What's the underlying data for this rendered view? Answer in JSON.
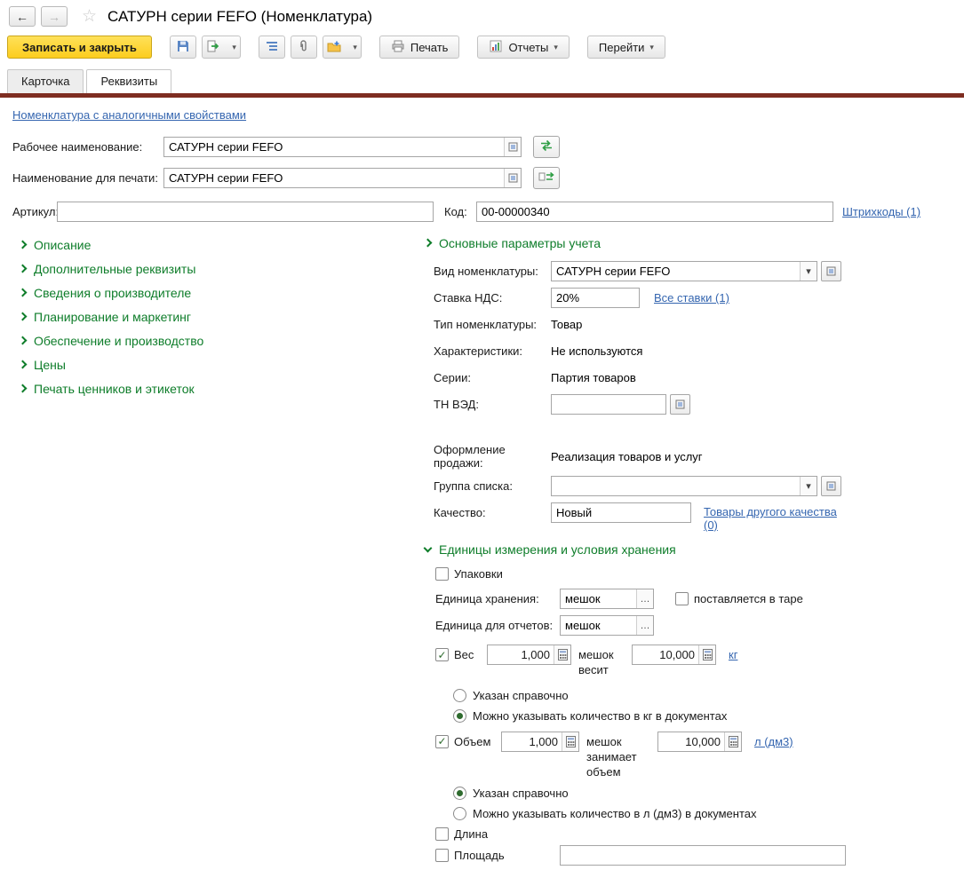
{
  "icons": {
    "back": "←",
    "forward": "→",
    "star": "☆",
    "dropdown": "▾",
    "ellipsis": "…",
    "check": "✓"
  },
  "colors": {
    "section_green": "#0e7d2a",
    "link_blue": "#3566b0",
    "primary_button_yellow": "#fccd1e",
    "tab_accent_maroon": "#7e2d21"
  },
  "window": {
    "title": "САТУРН серии FEFO (Номенклатура)"
  },
  "toolbar": {
    "save_close": "Записать и закрыть",
    "print": "Печать",
    "reports": "Отчеты",
    "goto": "Перейти"
  },
  "tabs": {
    "card": "Карточка",
    "details": "Реквизиты"
  },
  "top": {
    "similar_link": "Номенклатура с аналогичными свойствами",
    "working_name": {
      "label": "Рабочее наименование:",
      "value": "САТУРН серии FEFO"
    },
    "print_name": {
      "label": "Наименование для печати:",
      "value": "САТУРН серии FEFO"
    },
    "article": {
      "label": "Артикул:",
      "value": ""
    },
    "code": {
      "label": "Код:",
      "value": "00-00000340"
    },
    "barcodes_link": "Штрихкоды (1)"
  },
  "left_sections": [
    "Описание",
    "Дополнительные реквизиты",
    "Сведения о производителе",
    "Планирование и маркетинг",
    "Обеспечение и производство",
    "Цены",
    "Печать ценников и этикеток"
  ],
  "main_params": {
    "header": "Основные параметры учета",
    "kind": {
      "label": "Вид номенклатуры:",
      "value": "САТУРН серии FEFO"
    },
    "vat": {
      "label": "Ставка НДС:",
      "value": "20%",
      "link": "Все ставки (1)"
    },
    "type": {
      "label": "Тип номенклатуры:",
      "value": "Товар"
    },
    "characteristics": {
      "label": "Характеристики:",
      "value": "Не используются"
    },
    "series": {
      "label": "Серии:",
      "value": "Партия товаров"
    },
    "tnved": {
      "label": "ТН ВЭД:",
      "value": ""
    },
    "sale": {
      "label": "Оформление продажи:",
      "value": "Реализация товаров и услуг"
    },
    "list_group": {
      "label": "Группа списка:",
      "value": ""
    },
    "quality": {
      "label": "Качество:",
      "value": "Новый",
      "link": "Товары другого качества (0)"
    }
  },
  "units": {
    "header": "Единицы измерения и условия хранения",
    "packages": "Упаковки",
    "storage_unit": {
      "label": "Единица хранения:",
      "value": "мешок"
    },
    "in_container": "поставляется в таре",
    "report_unit": {
      "label": "Единица для отчетов:",
      "value": "мешок"
    },
    "weight": {
      "label": "Вес",
      "value1": "1,000",
      "middle": "мешок весит",
      "value2": "10,000",
      "unit": "кг",
      "option1": "Указан справочно",
      "option2": "Можно указывать количество в кг в документах"
    },
    "volume": {
      "label": "Объем",
      "value1": "1,000",
      "middle": "мешок занимает объем",
      "value2": "10,000",
      "unit": "л (дм3)",
      "option1": "Указан справочно",
      "option2": "Можно указывать количество в л (дм3) в документах"
    },
    "length": "Длина",
    "area": "Площадь"
  }
}
